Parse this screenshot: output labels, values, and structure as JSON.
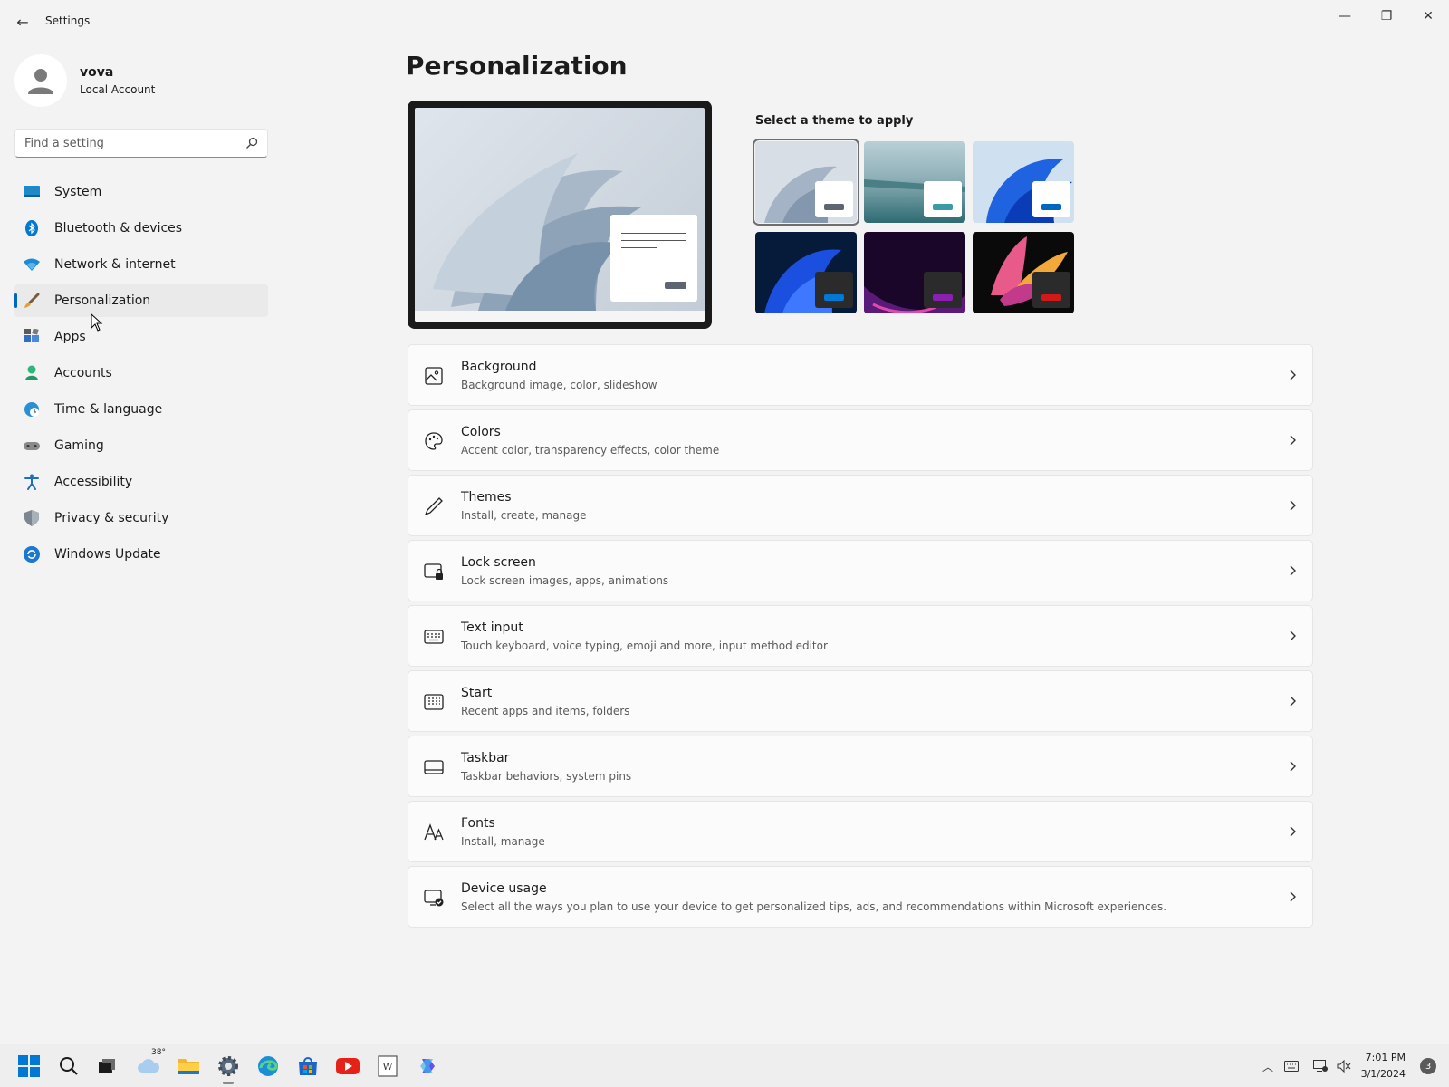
{
  "window": {
    "title": "Settings",
    "back_label": "←",
    "minimize_label": "—",
    "maximize_label": "❐",
    "close_label": "✕"
  },
  "profile": {
    "name": "vova",
    "account_type": "Local Account"
  },
  "search": {
    "placeholder": "Find a setting"
  },
  "sidebar": {
    "selected": "Personalization",
    "items": [
      {
        "label": "System",
        "icon": "monitor-icon"
      },
      {
        "label": "Bluetooth & devices",
        "icon": "bluetooth-icon"
      },
      {
        "label": "Network & internet",
        "icon": "wifi-icon"
      },
      {
        "label": "Personalization",
        "icon": "brush-icon"
      },
      {
        "label": "Apps",
        "icon": "apps-icon"
      },
      {
        "label": "Accounts",
        "icon": "person-icon"
      },
      {
        "label": "Time & language",
        "icon": "globe-clock-icon"
      },
      {
        "label": "Gaming",
        "icon": "controller-icon"
      },
      {
        "label": "Accessibility",
        "icon": "accessibility-icon"
      },
      {
        "label": "Privacy & security",
        "icon": "shield-icon"
      },
      {
        "label": "Windows Update",
        "icon": "sync-icon"
      }
    ]
  },
  "main": {
    "page_title": "Personalization",
    "theme_prompt": "Select a theme to apply",
    "themes": [
      {
        "name": "windows-light",
        "selected": true,
        "accent": "#5d6570"
      },
      {
        "name": "glow",
        "selected": false,
        "accent": "#3a9aa6"
      },
      {
        "name": "windows-blue-light",
        "selected": false,
        "accent": "#0067c0"
      },
      {
        "name": "windows-dark",
        "selected": false,
        "accent": "#0078d4"
      },
      {
        "name": "captured-motion",
        "selected": false,
        "accent": "#8a1fb0"
      },
      {
        "name": "flow",
        "selected": false,
        "accent": "#d01919"
      }
    ],
    "settings": [
      {
        "title": "Background",
        "desc": "Background image, color, slideshow",
        "icon": "image-icon"
      },
      {
        "title": "Colors",
        "desc": "Accent color, transparency effects, color theme",
        "icon": "palette-icon"
      },
      {
        "title": "Themes",
        "desc": "Install, create, manage",
        "icon": "pen-icon"
      },
      {
        "title": "Lock screen",
        "desc": "Lock screen images, apps, animations",
        "icon": "lock-screen-icon"
      },
      {
        "title": "Text input",
        "desc": "Touch keyboard, voice typing, emoji and more, input method editor",
        "icon": "keyboard-icon"
      },
      {
        "title": "Start",
        "desc": "Recent apps and items, folders",
        "icon": "start-grid-icon"
      },
      {
        "title": "Taskbar",
        "desc": "Taskbar behaviors, system pins",
        "icon": "taskbar-icon"
      },
      {
        "title": "Fonts",
        "desc": "Install, manage",
        "icon": "fonts-icon"
      },
      {
        "title": "Device usage",
        "desc": "Select all the ways you plan to use your device to get personalized tips, ads, and recommendations within Microsoft experiences.",
        "icon": "device-usage-icon"
      }
    ]
  },
  "taskbar": {
    "weather_temp": "38°",
    "time": "7:01 PM",
    "date": "3/1/2024",
    "notification_count": "3"
  },
  "colors": {
    "accent": "#0067c0",
    "background": "#f3f3f3",
    "card": "#fbfbfb"
  }
}
